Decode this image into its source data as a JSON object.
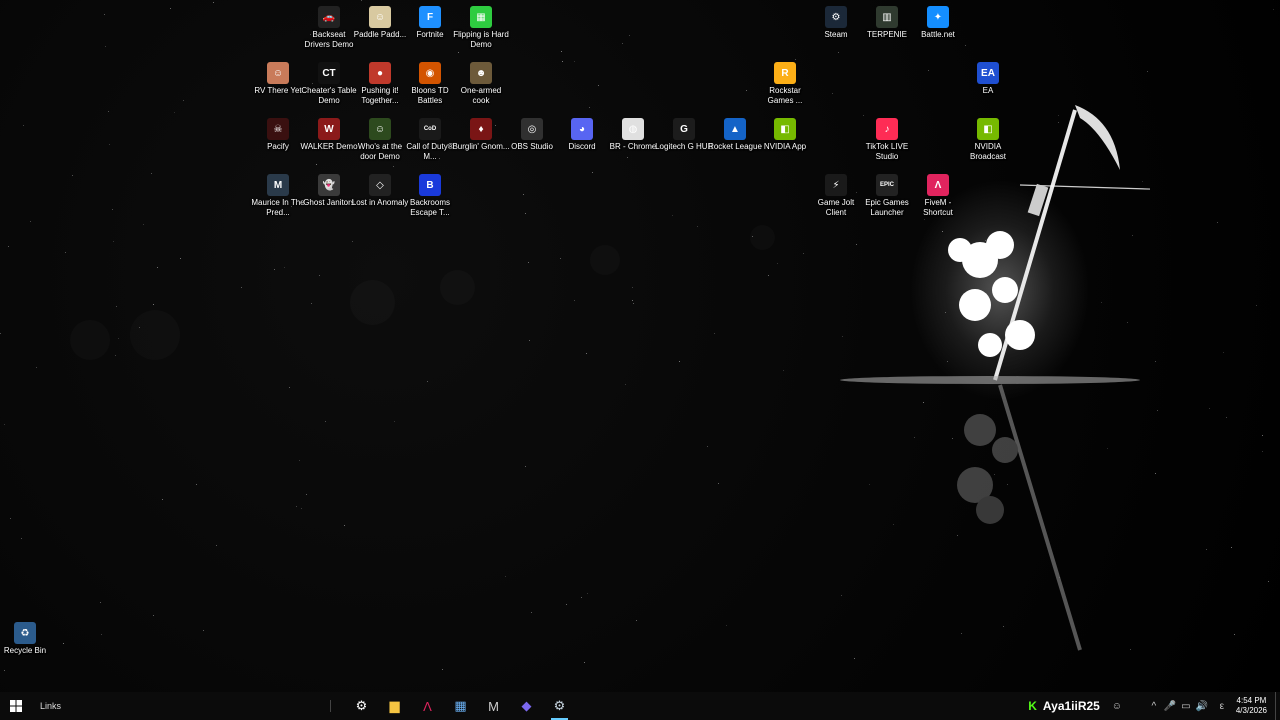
{
  "desktop": {
    "icons": [
      {
        "label": "Backseat Drivers Demo",
        "color": "#222222",
        "glyph": "🚗"
      },
      {
        "label": "Paddle Padd...",
        "color": "#d8c9a0",
        "glyph": "☺"
      },
      {
        "label": "Fortnite",
        "color": "#1e90ff",
        "glyph": "F"
      },
      {
        "label": "Flipping is Hard Demo",
        "color": "#2ecc40",
        "glyph": "▦"
      },
      {
        "label": "Steam",
        "color": "#1b2838",
        "glyph": "⚙"
      },
      {
        "label": "TERPENIE",
        "color": "#2f3a2f",
        "glyph": "▥"
      },
      {
        "label": "Battle.net",
        "color": "#148eff",
        "glyph": "✦"
      },
      {
        "label": "RV There Yet",
        "color": "#c97b5a",
        "glyph": "☺"
      },
      {
        "label": "Cheater's Table Demo",
        "color": "#111111",
        "glyph": "CT"
      },
      {
        "label": "Pushing it! Together...",
        "color": "#c0392b",
        "glyph": "●"
      },
      {
        "label": "Bloons TD Battles",
        "color": "#d35400",
        "glyph": "◉"
      },
      {
        "label": "One-armed cook",
        "color": "#6d5a3a",
        "glyph": "☻"
      },
      {
        "label": "Rockstar Games ...",
        "color": "#fcaf17",
        "glyph": "R"
      },
      {
        "label": "EA",
        "color": "#1f4fd1",
        "glyph": "EA"
      },
      {
        "label": "Pacify",
        "color": "#3a1010",
        "glyph": "☠"
      },
      {
        "label": "WALKER Demo",
        "color": "#8b1a1a",
        "glyph": "W"
      },
      {
        "label": "Who's at the door Demo",
        "color": "#2d4a1e",
        "glyph": "☺"
      },
      {
        "label": "Call of Duty® M...",
        "color": "#1a1a1a",
        "glyph": "CoD"
      },
      {
        "label": "Burglin' Gnom...",
        "color": "#7a1515",
        "glyph": "♦"
      },
      {
        "label": "OBS Studio",
        "color": "#303030",
        "glyph": "◎"
      },
      {
        "label": "Discord",
        "color": "#5865f2",
        "glyph": "◕"
      },
      {
        "label": "BR - Chrome",
        "color": "#e0e0e0",
        "glyph": "◍"
      },
      {
        "label": "Logitech G HUB",
        "color": "#1c1c1c",
        "glyph": "G"
      },
      {
        "label": "Rocket League",
        "color": "#1463c7",
        "glyph": "▲"
      },
      {
        "label": "NVIDIA App",
        "color": "#76b900",
        "glyph": "◧"
      },
      {
        "label": "TikTok LIVE Studio",
        "color": "#fe2c55",
        "glyph": "♪"
      },
      {
        "label": "NVIDIA Broadcast",
        "color": "#76b900",
        "glyph": "◧"
      },
      {
        "label": "Maurice In The Pred...",
        "color": "#2a3a4a",
        "glyph": "M"
      },
      {
        "label": "Ghost Janitors",
        "color": "#3a3a3a",
        "glyph": "👻"
      },
      {
        "label": "Lost in Anomaly",
        "color": "#222222",
        "glyph": "◇"
      },
      {
        "label": "Backrooms Escape T...",
        "color": "#1a3adb",
        "glyph": "B"
      },
      {
        "label": "Game Jolt Client",
        "color": "#1a1a1a",
        "glyph": "⚡"
      },
      {
        "label": "Epic Games Launcher",
        "color": "#222222",
        "glyph": "EPIC"
      },
      {
        "label": "FiveM - Shortcut",
        "color": "#e0245e",
        "glyph": "Λ"
      },
      {
        "label": "Recycle Bin",
        "color": "#2b5b8c",
        "glyph": "♻"
      }
    ]
  },
  "taskbar": {
    "links_label": "Links",
    "username": "Aya1iiR25",
    "kick_glyph": "K",
    "time": "4:54 PM",
    "date": "4/3/2026",
    "apps": [
      {
        "name": "steelseries-gg",
        "glyph": "⚙",
        "color": "#ffffff"
      },
      {
        "name": "file-explorer",
        "glyph": "▆",
        "color": "#f5c542"
      },
      {
        "name": "fivem",
        "glyph": "Λ",
        "color": "#e0245e"
      },
      {
        "name": "microsoft-store",
        "glyph": "▦",
        "color": "#6ab0f3"
      },
      {
        "name": "unknown-app",
        "glyph": "M",
        "color": "#cccccc"
      },
      {
        "name": "linear-app",
        "glyph": "◆",
        "color": "#7b68ee"
      },
      {
        "name": "steam",
        "glyph": "⚙",
        "color": "#c7d5e0"
      }
    ],
    "tray_icons": [
      "^",
      "🎤",
      "▭",
      "🔊",
      "ε"
    ]
  }
}
